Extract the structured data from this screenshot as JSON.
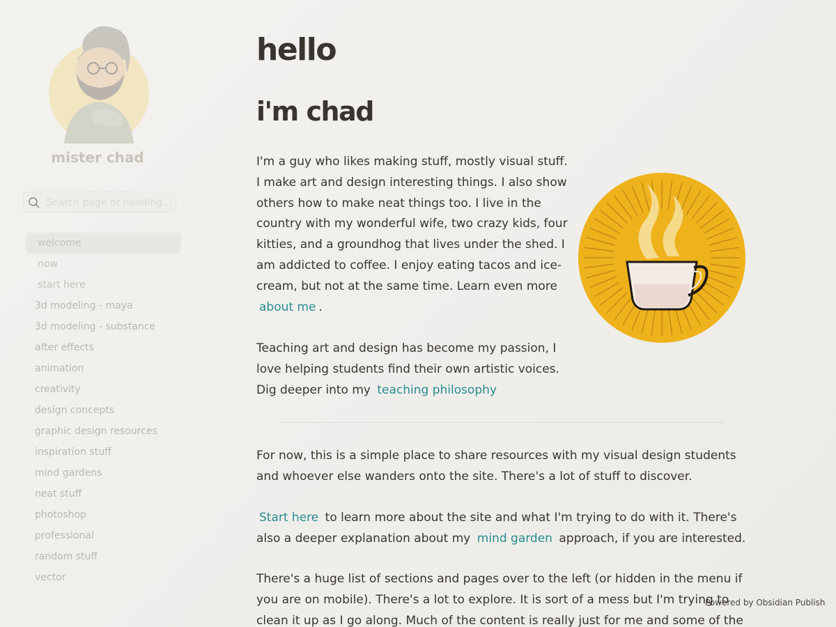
{
  "sidebar": {
    "site_name": "mister chad",
    "search_placeholder": "Search page or heading...",
    "items": [
      {
        "label": "welcome"
      },
      {
        "label": "now"
      },
      {
        "label": "start here"
      },
      {
        "label": "3d modeling - maya"
      },
      {
        "label": "3d modeling - substance"
      },
      {
        "label": "after effects"
      },
      {
        "label": "animation"
      },
      {
        "label": "creativity"
      },
      {
        "label": "design concepts"
      },
      {
        "label": "graphic design resources"
      },
      {
        "label": "inspiration stuff"
      },
      {
        "label": "mind gardens"
      },
      {
        "label": "neat stuff"
      },
      {
        "label": "photoshop"
      },
      {
        "label": "professional"
      },
      {
        "label": "random stuff"
      },
      {
        "label": "vector"
      }
    ]
  },
  "main": {
    "title": "hello",
    "subtitle": "i'm chad",
    "intro": {
      "text": "I'm a guy who likes making stuff, mostly visual stuff. I make art and design interesting things. I also show others how to make neat things too. I live in the coun­try with my wonderful wife, two crazy kids, four kit­ties, and a groundhog that lives under the shed. I am addicted to coffee. I enjoy eating tacos and ice-cream, but not at the same time. Learn even more",
      "link": "about me",
      "end": "."
    },
    "teaching": {
      "text": "Teaching art and design has become my passion, I love helping students find their own artistic voices. Dig deeper into my",
      "link": "teaching philosophy"
    },
    "for_now": "For now, this is a simple place to share resources with my visual design students and whoever else wanders onto the site. There's a lot of stuff to discover.",
    "start": {
      "link": "Start here",
      "text1": "to learn more about the site and what I'm trying to do with it. There's also a deeper explanation about my",
      "link2": "mind garden",
      "text2": "approach, if you are interested."
    },
    "sections": "There's a huge list of sections and pages over to the left (or hidden in the menu if you are on mobile). There's a lot to explore. It is sort of a mess but I'm trying to clean it up as I go along. Much of the content is really just for me and some of the pages"
  },
  "footer": {
    "powered": "Powered by Obsidian Publish"
  },
  "colors": {
    "link": "#2a8c8f",
    "coffee_bg": "#eeb21c"
  }
}
